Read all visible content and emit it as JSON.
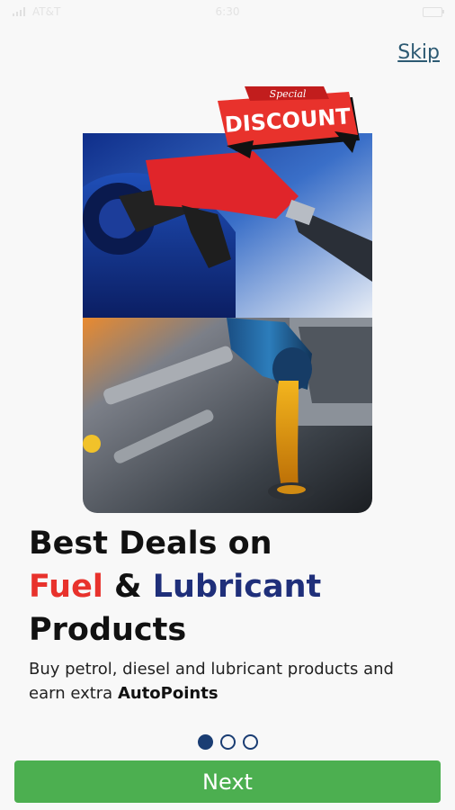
{
  "status_bar": {
    "carrier": "AT&T",
    "time": "6:30",
    "battery": "battery-icon",
    "signal": "signal-icon"
  },
  "onboarding": {
    "skip_label": "Skip",
    "badge": {
      "small": "Special",
      "big": "DISCOUNT"
    },
    "headline": {
      "line1": "Best Deals on",
      "fuel": "Fuel",
      "amp": "&",
      "lubricant": "Lubricant",
      "line3": "Products"
    },
    "subtitle": {
      "text": "Buy petrol, diesel and lubricant products and earn extra",
      "bold": "AutoPoints"
    },
    "page_indicator": {
      "current": 1,
      "total": 3
    },
    "next_label": "Next"
  },
  "colors": {
    "accent_red": "#e8322c",
    "accent_blue": "#1f2f7a",
    "button_green": "#4caf50",
    "dot_blue": "#1a3d73",
    "link_color": "#2d5a73"
  }
}
